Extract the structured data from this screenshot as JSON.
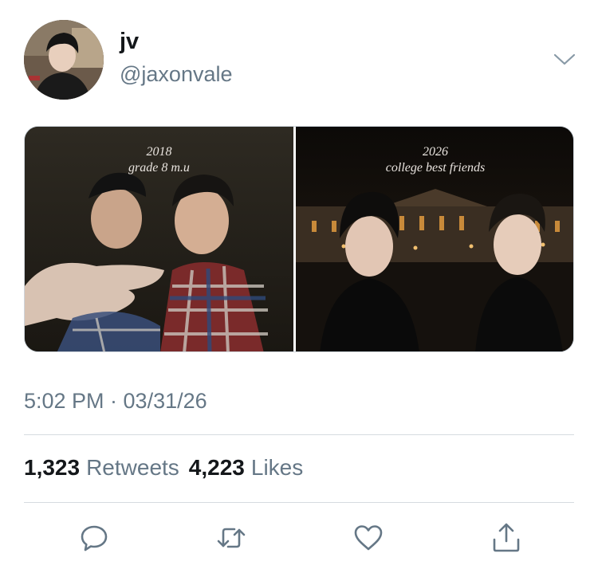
{
  "tweet": {
    "display_name": "jv",
    "handle": "@jaxonvale",
    "timestamp": "5:02 PM · 03/31/26",
    "retweets_count": "1,323",
    "retweets_label": "Retweets",
    "likes_count": "4,223",
    "likes_label": "Likes"
  },
  "media": {
    "left": {
      "year": "2018",
      "caption": "grade 8 m.u"
    },
    "right": {
      "year": "2026",
      "caption": "college best friends"
    }
  },
  "icons": {
    "menu": "chevron-down-icon",
    "reply": "reply-icon",
    "retweet": "retweet-icon",
    "like": "heart-icon",
    "share": "share-icon"
  },
  "colors": {
    "secondary_text": "#657786",
    "primary_text": "#14171a",
    "divider": "#d6dbe0"
  }
}
